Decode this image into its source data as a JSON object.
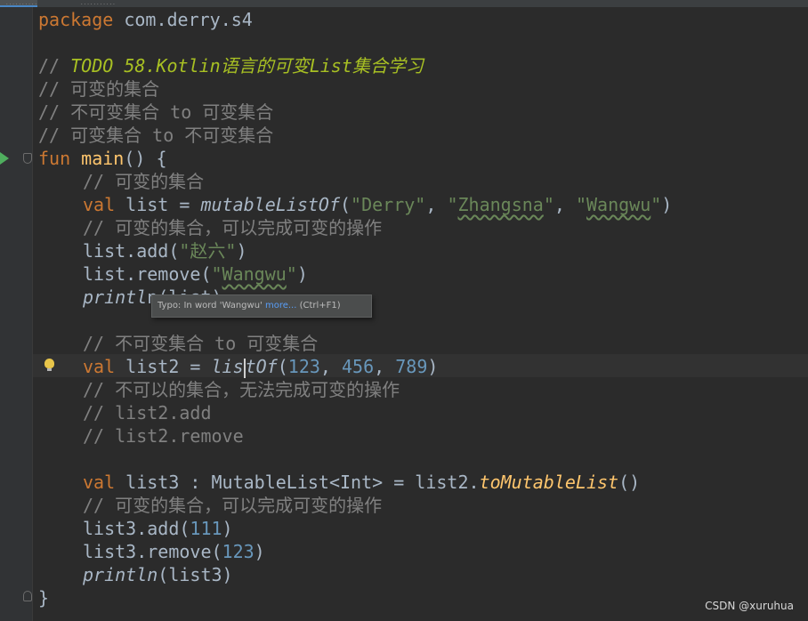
{
  "tabs": [
    {
      "label": "...........",
      "active": true
    },
    {
      "label": "...........",
      "active": false
    }
  ],
  "editor": {
    "colors": {
      "background": "#2b2b2b",
      "keyword": "#cc7832",
      "function": "#ffc66d",
      "string": "#6a8759",
      "number": "#6897bb",
      "comment": "#808080",
      "todo": "#a8c023",
      "plain": "#a9b7c6"
    },
    "code": {
      "l1_kw": "package",
      "l1_rest": " com.derry.s4",
      "l3": "// TODO 58.Kotlin语言的可变List集合学习",
      "l4": "// 可变的集合",
      "l5": "// 不可变集合 to 可变集合",
      "l6": "// 可变集合 to 不可变集合",
      "l7_kw": "fun",
      "l7_fn": "main",
      "l7_rest": "() {",
      "l8": "// 可变的集合",
      "l9_kw": "val",
      "l9_id": " list = ",
      "l9_fn": "mutableListOf",
      "l9_open": "(",
      "l9_s1": "\"Derry\"",
      "l9_c1": ", ",
      "l9_s2_q1": "\"",
      "l9_s2": "Zhangsna",
      "l9_s2_q2": "\"",
      "l9_c2": ", ",
      "l9_s3_q1": "\"",
      "l9_s3": "Wangwu",
      "l9_s3_q2": "\"",
      "l9_close": ")",
      "l10": "// 可变的集合，可以完成可变的操作",
      "l11_a": "list.add(",
      "l11_s": "\"赵六\"",
      "l11_b": ")",
      "l12_a": "list.remove(",
      "l12_q1": "\"",
      "l12_s": "Wangwu",
      "l12_q2": "\"",
      "l12_b": ")",
      "l13_fn": "printl",
      "l13_rest": "n(list)",
      "l15": "// 不可变集合 to 可变集合",
      "l16_kw": "val",
      "l16_id": " list2 = ",
      "l16_fn_a": "lis",
      "l16_fn_b": "tOf",
      "l16_open": "(",
      "l16_n1": "123",
      "l16_c1": ", ",
      "l16_n2": "456",
      "l16_c2": ", ",
      "l16_n3": "789",
      "l16_close": ")",
      "l17": "// 不可以的集合，无法完成可变的操作",
      "l18": "// list2.add",
      "l19": "// list2.remove",
      "l21_kw": "val",
      "l21_id": " list3 : MutableList<Int> = list2.",
      "l21_fn": "toMutableList",
      "l21_rest": "()",
      "l22": "// 可变的集合，可以完成可变的操作",
      "l23_a": "list3.add(",
      "l23_n": "111",
      "l23_b": ")",
      "l24_a": "list3.remove(",
      "l24_n": "123",
      "l24_b": ")",
      "l25_fn": "println",
      "l25_rest": "(list3)",
      "l26": "}"
    }
  },
  "tooltip": {
    "text": "Typo: In word 'Wangwu' ",
    "link": "more...",
    "shortcut": " (Ctrl+F1)"
  },
  "gutter": {
    "run_icon": "run-arrow-icon",
    "fold_icon": "fold-icon",
    "intention_icon": "lightbulb-icon"
  },
  "watermark": "CSDN @xuruhua"
}
